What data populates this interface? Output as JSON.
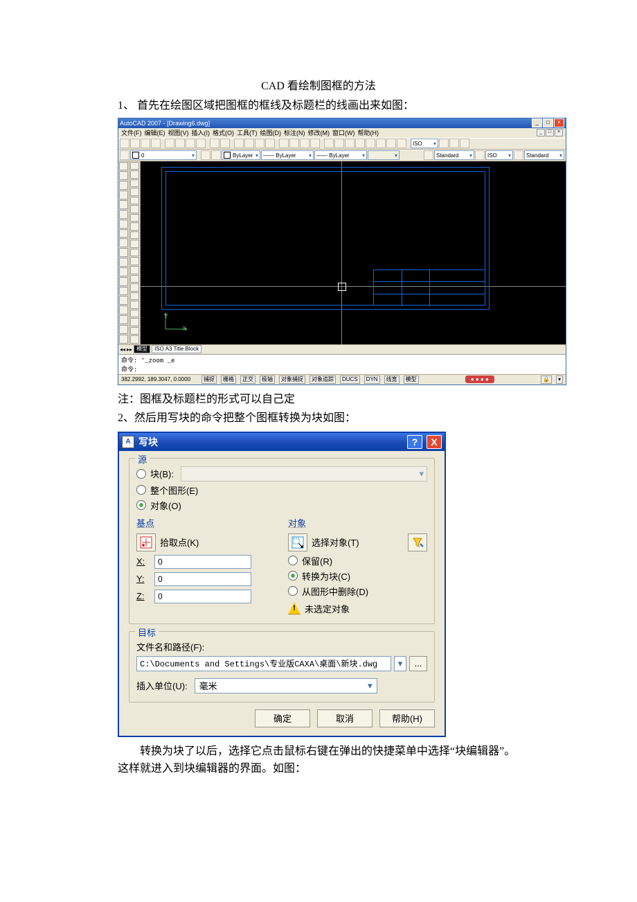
{
  "doc": {
    "title": "CAD 看绘制图框的方法",
    "step1": "1、  首先在绘图区域把图框的框线及标题栏的线画出来如图：",
    "note": "注：图框及标题栏的形式可以自己定",
    "step2": "2、然后用写块的命令把整个图框转换为块如图：",
    "para": "转换为块了以后，选择它点击鼠标右键在弹出的快捷菜单中选择“块编辑器”。这样就进入到块编辑器的界面。如图："
  },
  "cad": {
    "title": "AutoCAD 2007 - [Drawing6.dwg]",
    "menu": [
      "文件(F)",
      "编辑(E)",
      "视图(V)",
      "插入(I)",
      "格式(O)",
      "工具(T)",
      "绘图(D)",
      "标注(N)",
      "修改(M)",
      "窗口(W)",
      "帮助(H)"
    ],
    "layer": "ByLayer",
    "layername": "0",
    "style": "Standard",
    "dimstyle": "ISO",
    "tab_model": "模型",
    "tab_layout": "ISO A3 Title Block",
    "cmd1": "命令: '_zoom _e",
    "cmd2": "命令:",
    "status_coord": "382.2992, 189.3047, 0.0000",
    "status_btns": [
      "捕捉",
      "栅格",
      "正交",
      "极轴",
      "对象捕捉",
      "对象追踪",
      "DUCS",
      "DYN",
      "线宽",
      "模型"
    ],
    "ucs_y": "Y",
    "ucs_x": "X"
  },
  "dlg": {
    "title": "写块",
    "source_legend": "源",
    "opt_block": "块(B):",
    "opt_drawing": "整个图形(E)",
    "opt_objects": "对象(O)",
    "base_legend": "基点",
    "pick_point": "拾取点(K)",
    "x_label": "X:",
    "y_label": "Y:",
    "z_label": "Z:",
    "x_val": "0",
    "y_val": "0",
    "z_val": "0",
    "objects_legend": "对象",
    "select_objects": "选择对象(T)",
    "opt_retain": "保留(R)",
    "opt_convert": "转换为块(C)",
    "opt_delete": "从图形中删除(D)",
    "no_selection": "未选定对象",
    "dest_legend": "目标",
    "filename_label": "文件名和路径(F):",
    "path": "C:\\Documents and Settings\\专业版CAXA\\桌面\\新块.dwg",
    "browse": "...",
    "units_label": "插入单位(U):",
    "units_val": "毫米",
    "btn_ok": "确定",
    "btn_cancel": "取消",
    "btn_help": "帮助(H)",
    "help_icon": "?",
    "close_icon": "X",
    "dd_arrow": "▾"
  }
}
